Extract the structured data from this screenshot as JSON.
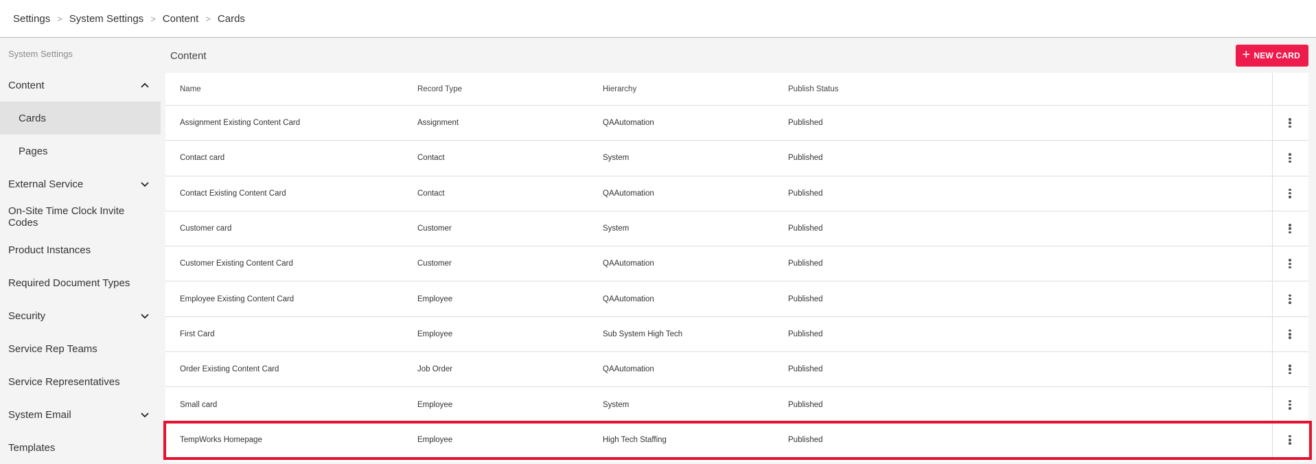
{
  "breadcrumb": [
    "Settings",
    "System Settings",
    "Content",
    "Cards"
  ],
  "sidebar": {
    "header": "System Settings",
    "items": [
      {
        "label": "Content",
        "chevron": "up"
      },
      {
        "label": "Cards",
        "sub": true,
        "active": true
      },
      {
        "label": "Pages",
        "sub": true
      },
      {
        "label": "External Service",
        "chevron": "down"
      },
      {
        "label": "On-Site Time Clock Invite Codes"
      },
      {
        "label": "Product Instances"
      },
      {
        "label": "Required Document Types"
      },
      {
        "label": "Security",
        "chevron": "down"
      },
      {
        "label": "Service Rep Teams"
      },
      {
        "label": "Service Representatives"
      },
      {
        "label": "System Email",
        "chevron": "down"
      },
      {
        "label": "Templates"
      }
    ]
  },
  "main": {
    "title": "Content",
    "new_button": "NEW CARD",
    "columns": [
      "Name",
      "Record Type",
      "Hierarchy",
      "Publish Status"
    ],
    "rows": [
      [
        "Assignment Existing Content Card",
        "Assignment",
        "QAAutomation",
        "Published"
      ],
      [
        "Contact card",
        "Contact",
        "System",
        "Published"
      ],
      [
        "Contact Existing Content Card",
        "Contact",
        "QAAutomation",
        "Published"
      ],
      [
        "Customer card",
        "Customer",
        "System",
        "Published"
      ],
      [
        "Customer Existing Content Card",
        "Customer",
        "QAAutomation",
        "Published"
      ],
      [
        "Employee Existing Content Card",
        "Employee",
        "QAAutomation",
        "Published"
      ],
      [
        "First Card",
        "Employee",
        "Sub System High Tech",
        "Published"
      ],
      [
        "Order Existing Content Card",
        "Job Order",
        "QAAutomation",
        "Published"
      ],
      [
        "Small card",
        "Employee",
        "System",
        "Published"
      ],
      [
        "TempWorks Homepage",
        "Employee",
        "High Tech Staffing",
        "Published"
      ]
    ]
  },
  "colors": {
    "accent": "#ee1c4d",
    "highlight": "#e4112f",
    "active_bg": "#e2e2e2"
  }
}
